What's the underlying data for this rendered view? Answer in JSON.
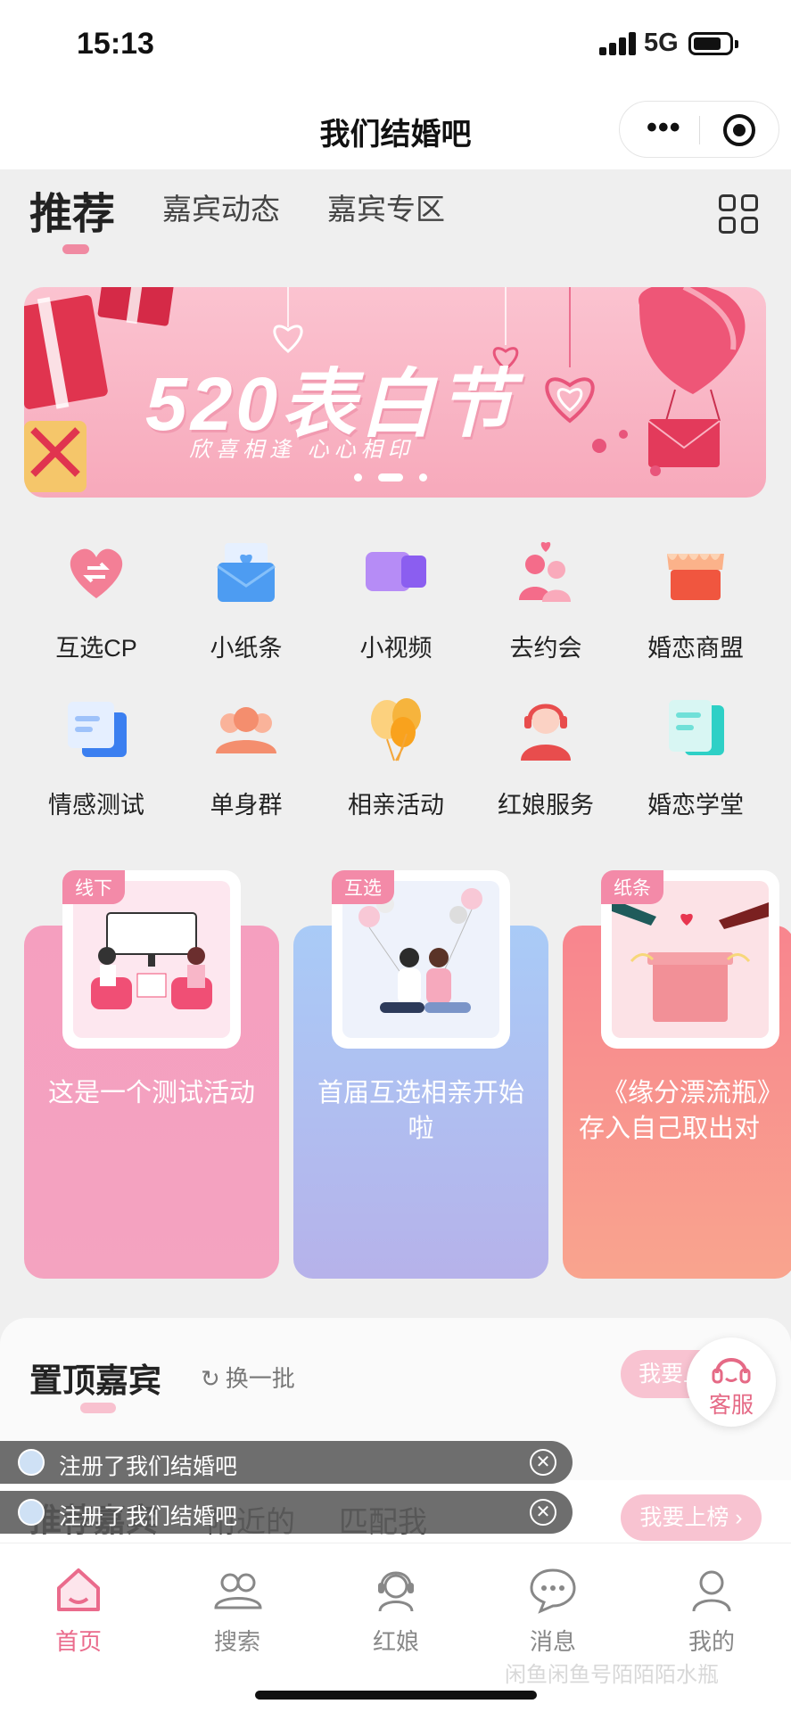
{
  "status": {
    "time": "15:13",
    "network": "5G"
  },
  "nav": {
    "title": "我们结婚吧"
  },
  "tabs": [
    "推荐",
    "嘉宾动态",
    "嘉宾专区"
  ],
  "banner": {
    "title": "520表白节",
    "subtitle": "欣喜相逢 心心相印"
  },
  "features": [
    {
      "label": "互选CP",
      "icon": "heart-swap-icon"
    },
    {
      "label": "小纸条",
      "icon": "envelope-heart-icon"
    },
    {
      "label": "小视频",
      "icon": "video-camera-icon"
    },
    {
      "label": "去约会",
      "icon": "couple-icon"
    },
    {
      "label": "婚恋商盟",
      "icon": "shop-awning-icon"
    },
    {
      "label": "情感测试",
      "icon": "quiz-card-icon"
    },
    {
      "label": "单身群",
      "icon": "group-people-icon"
    },
    {
      "label": "相亲活动",
      "icon": "balloons-icon"
    },
    {
      "label": "红娘服务",
      "icon": "matchmaker-headset-icon"
    },
    {
      "label": "婚恋学堂",
      "icon": "book-notes-icon"
    }
  ],
  "activities": [
    {
      "tag": "线下",
      "line1": "这是一个测试活动",
      "line2": ""
    },
    {
      "tag": "互选",
      "line1": "首届互选相亲开始",
      "line2": "啦"
    },
    {
      "tag": "纸条",
      "line1": "《缘分漂流瓶》",
      "line2": "存入自己取出对"
    }
  ],
  "featured": {
    "title": "置顶嘉宾",
    "refresh": "换一批",
    "rank_button": "我要上榜"
  },
  "service": {
    "label": "客服"
  },
  "toasts": [
    "注册了我们结婚吧",
    "注册了我们结婚吧"
  ],
  "recommend_tabs": [
    "推荐嘉宾",
    "附近的",
    "匹配我"
  ],
  "recommend_rank": "我要上榜 ›",
  "tabbar": [
    {
      "label": "首页",
      "icon": "home-icon"
    },
    {
      "label": "搜索",
      "icon": "people-search-icon"
    },
    {
      "label": "红娘",
      "icon": "matchmaker-icon"
    },
    {
      "label": "消息",
      "icon": "chat-bubble-icon"
    },
    {
      "label": "我的",
      "icon": "profile-icon"
    }
  ],
  "watermark": "闲鱼闲鱼号陌陌陌水瓶",
  "colors": {
    "accent": "#ea6b8c",
    "pink_light": "#f8c3d1"
  }
}
